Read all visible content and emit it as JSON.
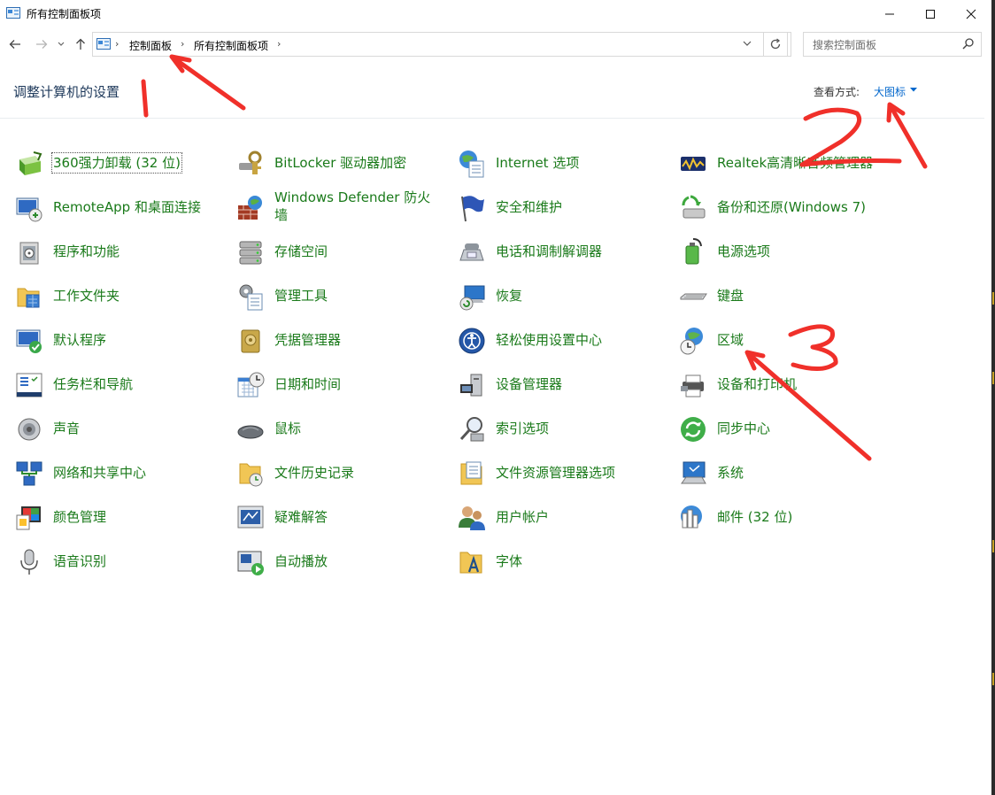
{
  "window": {
    "title": "所有控制面板项",
    "controls": {
      "minimize": "minimize",
      "maximize": "maximize",
      "close": "close"
    }
  },
  "nav": {
    "breadcrumb": [
      "控制面板",
      "所有控制面板项"
    ],
    "search_placeholder": "搜索控制面板"
  },
  "header": {
    "title": "调整计算机的设置",
    "view_by_label": "查看方式:",
    "view_by_value": "大图标"
  },
  "items": [
    {
      "label": "360强力卸载 (32 位)",
      "icon": "uninstall-icon"
    },
    {
      "label": "BitLocker 驱动器加密",
      "icon": "bitlocker-icon"
    },
    {
      "label": "Internet 选项",
      "icon": "internet-options-icon"
    },
    {
      "label": "Realtek高清晰音频管理器",
      "icon": "realtek-audio-icon"
    },
    {
      "label": "RemoteApp 和桌面连接",
      "icon": "remoteapp-icon"
    },
    {
      "label": "Windows Defender 防火墙",
      "icon": "firewall-icon"
    },
    {
      "label": "安全和维护",
      "icon": "security-flag-icon"
    },
    {
      "label": "备份和还原(Windows 7)",
      "icon": "backup-icon"
    },
    {
      "label": "程序和功能",
      "icon": "programs-icon"
    },
    {
      "label": "存储空间",
      "icon": "storage-icon"
    },
    {
      "label": "电话和调制解调器",
      "icon": "phone-modem-icon"
    },
    {
      "label": "电源选项",
      "icon": "power-icon"
    },
    {
      "label": "工作文件夹",
      "icon": "work-folders-icon"
    },
    {
      "label": "管理工具",
      "icon": "admin-tools-icon"
    },
    {
      "label": "恢复",
      "icon": "recovery-icon"
    },
    {
      "label": "键盘",
      "icon": "keyboard-icon"
    },
    {
      "label": "默认程序",
      "icon": "default-programs-icon"
    },
    {
      "label": "凭据管理器",
      "icon": "credential-icon"
    },
    {
      "label": "轻松使用设置中心",
      "icon": "ease-of-access-icon"
    },
    {
      "label": "区域",
      "icon": "region-icon"
    },
    {
      "label": "任务栏和导航",
      "icon": "taskbar-icon"
    },
    {
      "label": "日期和时间",
      "icon": "date-time-icon"
    },
    {
      "label": "设备管理器",
      "icon": "device-manager-icon"
    },
    {
      "label": "设备和打印机",
      "icon": "printer-icon"
    },
    {
      "label": "声音",
      "icon": "sound-icon"
    },
    {
      "label": "鼠标",
      "icon": "mouse-icon"
    },
    {
      "label": "索引选项",
      "icon": "indexing-icon"
    },
    {
      "label": "同步中心",
      "icon": "sync-icon"
    },
    {
      "label": "网络和共享中心",
      "icon": "network-icon"
    },
    {
      "label": "文件历史记录",
      "icon": "file-history-icon"
    },
    {
      "label": "文件资源管理器选项",
      "icon": "explorer-options-icon"
    },
    {
      "label": "系统",
      "icon": "system-icon"
    },
    {
      "label": "颜色管理",
      "icon": "color-management-icon"
    },
    {
      "label": "疑难解答",
      "icon": "troubleshooting-icon"
    },
    {
      "label": "用户帐户",
      "icon": "user-accounts-icon"
    },
    {
      "label": "邮件 (32 位)",
      "icon": "mail-icon"
    },
    {
      "label": "语音识别",
      "icon": "speech-icon"
    },
    {
      "label": "自动播放",
      "icon": "autoplay-icon"
    },
    {
      "label": "字体",
      "icon": "fonts-icon"
    }
  ],
  "annotations": {
    "color": "#f0302a"
  },
  "colors": {
    "link_green": "#1a7a1a",
    "heading": "#1e395b",
    "link_blue": "#0066cc"
  }
}
